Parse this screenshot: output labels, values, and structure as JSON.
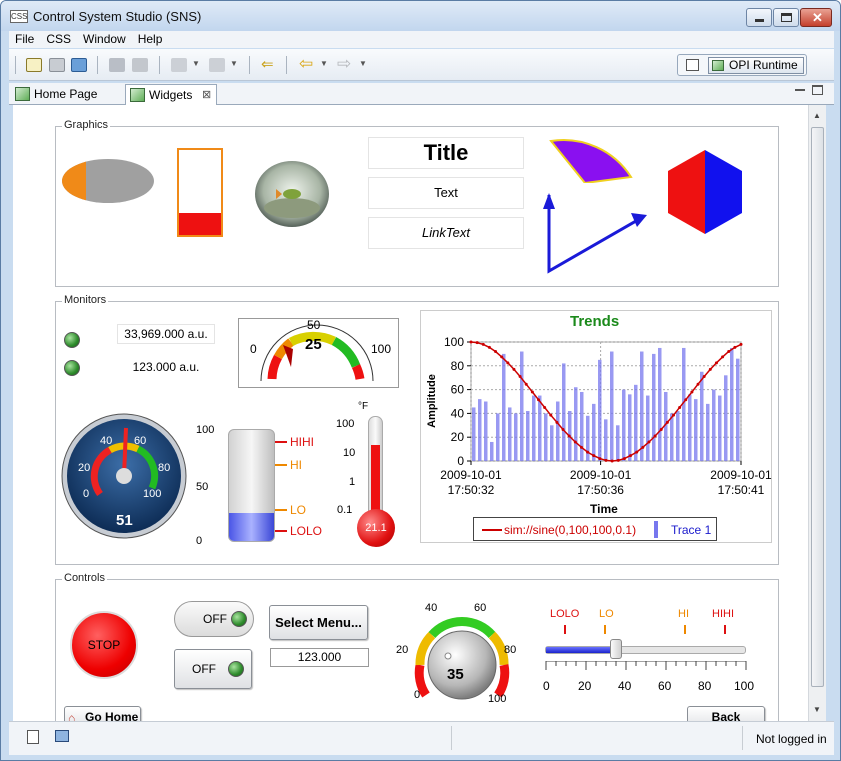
{
  "window": {
    "title": "Control System Studio (SNS)",
    "app_icon_text": "CSS"
  },
  "menu": [
    "File",
    "CSS",
    "Window",
    "Help"
  ],
  "perspective": {
    "label": "OPI Runtime"
  },
  "tabs": [
    {
      "label": "Home Page"
    },
    {
      "label": "Widgets"
    }
  ],
  "groups": {
    "graphics": "Graphics",
    "monitors": "Monitors",
    "controls": "Controls"
  },
  "graphics": {
    "title_label": "Title",
    "text_label": "Text",
    "link_label": "LinkText"
  },
  "monitors": {
    "value1": "33,969.000 a.u.",
    "value2": "123.000 a.u.",
    "meter": {
      "min": "0",
      "mid": "50",
      "max": "100",
      "value": "25"
    },
    "gauge": {
      "ticks": [
        "0",
        "20",
        "40",
        "60",
        "80",
        "100"
      ],
      "value": "51",
      "value_fraction": 0.51
    },
    "tank": {
      "ticks": [
        "100",
        "50",
        "0"
      ],
      "levels": [
        "HIHI",
        "HI",
        "LO",
        "LOLO"
      ],
      "fill_fraction": 0.25
    },
    "thermo": {
      "unit": "°F",
      "ticks": [
        "100",
        "10",
        "1",
        "0.1"
      ],
      "value": "21.1"
    }
  },
  "chart_data": {
    "type": "line",
    "title": "Trends",
    "xlabel": "Time",
    "ylabel": "Amplitude",
    "x_ticks": [
      "2009-10-01\n17:50:32",
      "2009-10-01\n17:50:36",
      "2009-10-01\n17:50:41"
    ],
    "y_ticks": [
      "0",
      "20",
      "40",
      "60",
      "80",
      "100"
    ],
    "ylim": [
      0,
      100
    ],
    "grid": true,
    "legend_position": "bottom",
    "series": [
      {
        "name": "sim://sine(0,100,100,0.1)",
        "color": "#cc0000",
        "kind": "line",
        "values": [
          100,
          99.5,
          98,
          95.5,
          92,
          87.5,
          82.5,
          77,
          71,
          64.5,
          58,
          51.5,
          45,
          38.5,
          32.5,
          26.5,
          21,
          16,
          11.5,
          7.5,
          4.5,
          2,
          0.5,
          0,
          0.5,
          2,
          4.5,
          7.5,
          11.5,
          16,
          21,
          26.5,
          32.5,
          38.5,
          45,
          51.5,
          58,
          64.5,
          71,
          77,
          82.5,
          87.5,
          92,
          95.5,
          98
        ]
      },
      {
        "name": "Trace 1",
        "color": "#7777ee",
        "kind": "bar",
        "values": [
          45,
          52,
          50,
          16,
          40,
          90,
          45,
          40,
          92,
          42,
          55,
          55,
          40,
          30,
          50,
          82,
          42,
          62,
          58,
          38,
          48,
          85,
          35,
          92,
          30,
          60,
          56,
          64,
          92,
          55,
          90,
          95,
          58,
          40,
          42,
          95,
          56,
          52,
          75,
          48,
          60,
          55,
          72,
          95,
          86
        ]
      }
    ]
  },
  "controls": {
    "stop": "STOP",
    "toggle1": "OFF",
    "toggle2": "OFF",
    "menu_button": "Select Menu...",
    "text_input": "123.000",
    "knob": {
      "ticks": [
        "0",
        "20",
        "40",
        "60",
        "80",
        "100"
      ],
      "value": "35",
      "value_fraction": 0.35
    },
    "slider": {
      "levels": [
        "LOLO",
        "LO",
        "HI",
        "HIHI"
      ],
      "ticks": [
        "0",
        "20",
        "40",
        "60",
        "80",
        "100"
      ],
      "value_fraction": 0.35
    },
    "go_home": "Go Home",
    "back": "Back"
  },
  "status": {
    "login": "Not logged in"
  }
}
